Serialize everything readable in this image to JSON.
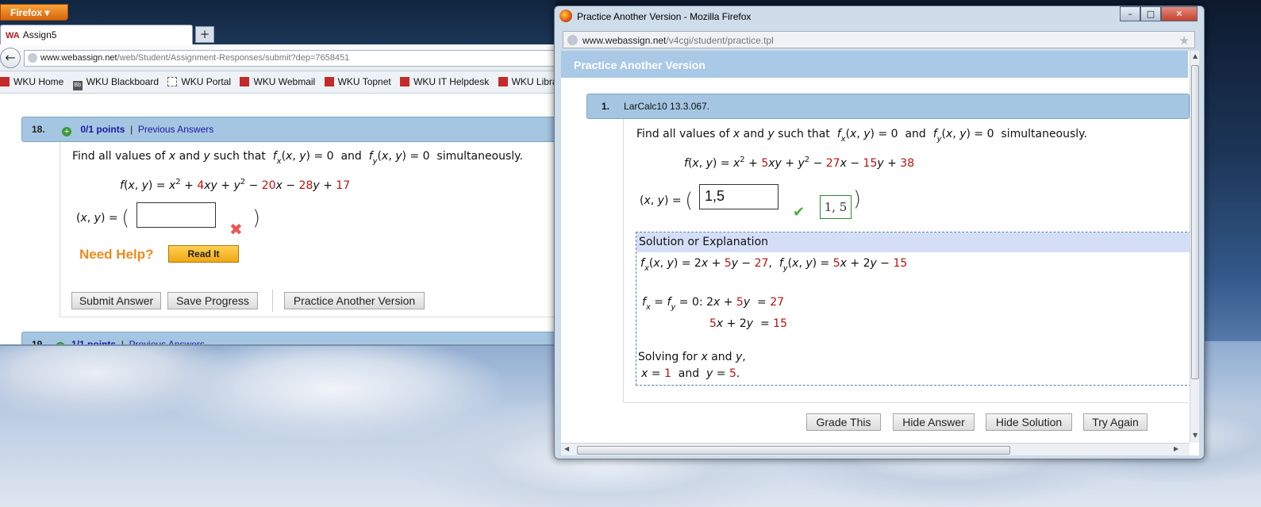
{
  "main": {
    "firefox_menu": "Firefox",
    "tab_logo": "WA",
    "tab_title": "Assign5",
    "newtab_label": "+",
    "url_domain": "www.webassign.net",
    "url_path": "/web/Student/Assignment-Responses/submit?dep=7658451",
    "bookmarks": [
      "WKU Home",
      "WKU Blackboard",
      "WKU Portal",
      "WKU Webmail",
      "WKU Topnet",
      "WKU IT Helpdesk",
      "WKU Libraries"
    ],
    "question": {
      "number": "18.",
      "points": "0/1 points",
      "separator": "|",
      "prev": "Previous Answers",
      "prompt_start": "Find all values of",
      "prompt_and": "and",
      "prompt_such": "such that",
      "prompt_simul": "simultaneously.",
      "func_coeffs": {
        "c1": "4",
        "c2": "20",
        "c3": "28",
        "c4": "17"
      },
      "answer_value": "",
      "need_help": "Need Help?",
      "read_it": "Read It",
      "submit": "Submit Answer",
      "save": "Save Progress",
      "practice": "Practice Another Version"
    },
    "next_question": {
      "number": "19.",
      "points": "1/1 points",
      "prev": "Previous Answers"
    }
  },
  "popup": {
    "title": "Practice Another Version - Mozilla Firefox",
    "url_domain": "www.webassign.net",
    "url_path": "/v4cgi/student/practice.tpl",
    "header": "Practice Another Version",
    "q_number": "1.",
    "q_code": "LarCalc10 13.3.067.",
    "func_coeffs": {
      "c1": "5",
      "c2": "27",
      "c3": "15",
      "c4": "38"
    },
    "answer_value": "1,5",
    "correct_answer": "1, 5",
    "solution_heading": "Solution or Explanation",
    "sol": {
      "c_fx1": "5",
      "c_fx2": "27",
      "c_fy1": "5",
      "c_fy2": "15",
      "eq1_rhs": "27",
      "eq2_c": "5",
      "eq2_rhs": "15",
      "solving": "Solving for",
      "x_val": "1",
      "y_val": "5"
    },
    "buttons": {
      "grade": "Grade This",
      "hide_answer": "Hide Answer",
      "hide_solution": "Hide Solution",
      "try_again": "Try Again"
    }
  }
}
